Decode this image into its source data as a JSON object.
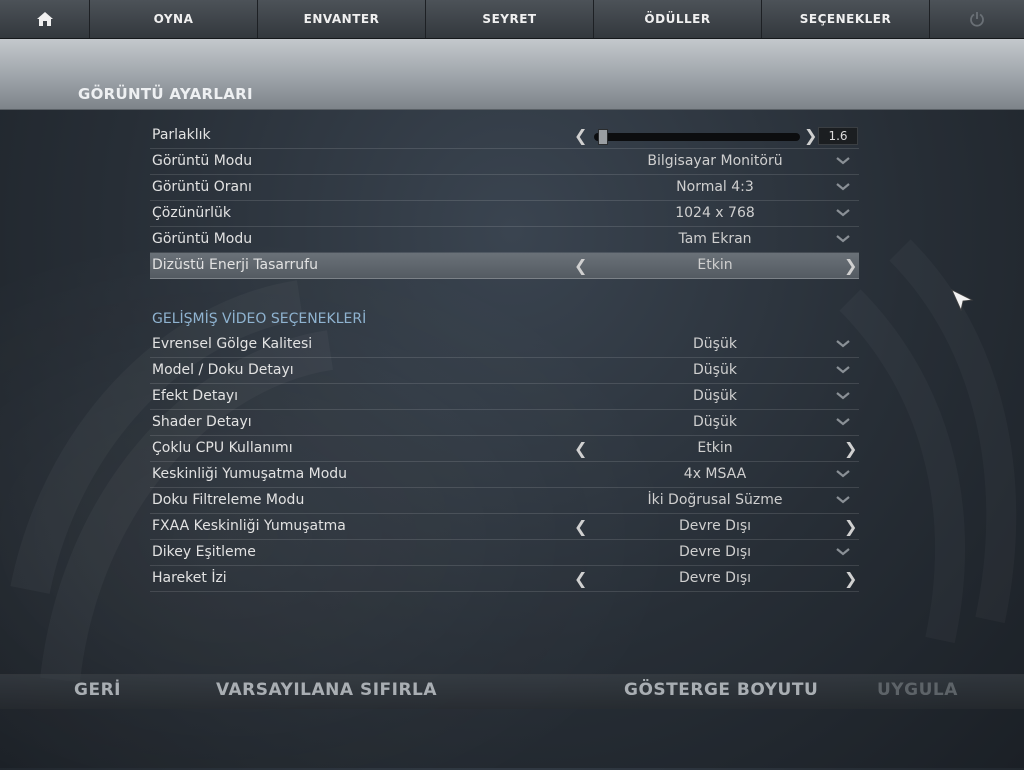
{
  "nav": {
    "home_icon": "home-icon",
    "items": [
      "OYNA",
      "ENVANTER",
      "SEYRET",
      "ÖDÜLLER",
      "SEÇENEKLER"
    ],
    "power_icon": "power-icon"
  },
  "page": {
    "title": "GÖRÜNTÜ AYARLARI"
  },
  "display": {
    "brightness": {
      "label": "Parlaklık",
      "value": "1.6",
      "level_fraction": 0.02
    },
    "rows": [
      {
        "label": "Görüntü Modu",
        "value": "Bilgisayar Monitörü",
        "control": "dropdown"
      },
      {
        "label": "Görüntü Oranı",
        "value": "Normal 4:3",
        "control": "dropdown"
      },
      {
        "label": "Çözünürlük",
        "value": "1024 x 768",
        "control": "dropdown"
      },
      {
        "label": "Görüntü Modu",
        "value": "Tam Ekran",
        "control": "dropdown"
      },
      {
        "label": "Dizüstü Enerji Tasarrufu",
        "value": "Etkin",
        "control": "cycle"
      }
    ]
  },
  "advanced": {
    "title": "GELİŞMİŞ VİDEO SEÇENEKLERİ",
    "rows": [
      {
        "label": "Evrensel Gölge Kalitesi",
        "value": "Düşük",
        "control": "dropdown"
      },
      {
        "label": "Model / Doku Detayı",
        "value": "Düşük",
        "control": "dropdown"
      },
      {
        "label": "Efekt Detayı",
        "value": "Düşük",
        "control": "dropdown"
      },
      {
        "label": "Shader Detayı",
        "value": "Düşük",
        "control": "dropdown"
      },
      {
        "label": "Çoklu CPU Kullanımı",
        "value": "Etkin",
        "control": "cycle"
      },
      {
        "label": "Keskinliği Yumuşatma Modu",
        "value": "4x MSAA",
        "control": "dropdown"
      },
      {
        "label": "Doku Filtreleme Modu",
        "value": "İki Doğrusal Süzme",
        "control": "dropdown"
      },
      {
        "label": "FXAA Keskinliği Yumuşatma",
        "value": "Devre Dışı",
        "control": "cycle"
      },
      {
        "label": "Dikey Eşitleme",
        "value": "Devre Dışı",
        "control": "dropdown"
      },
      {
        "label": "Hareket İzi",
        "value": "Devre Dışı",
        "control": "cycle"
      }
    ]
  },
  "footer": {
    "back": "GERİ",
    "reset": "VARSAYILANA SIFIRLA",
    "hud_scale": "GÖSTERGE BOYUTU",
    "apply": "UYGULA"
  },
  "colors": {
    "section_title": "#8fb3d0",
    "highlight_row": "#5f666d",
    "disabled_text": "#5d6368"
  }
}
